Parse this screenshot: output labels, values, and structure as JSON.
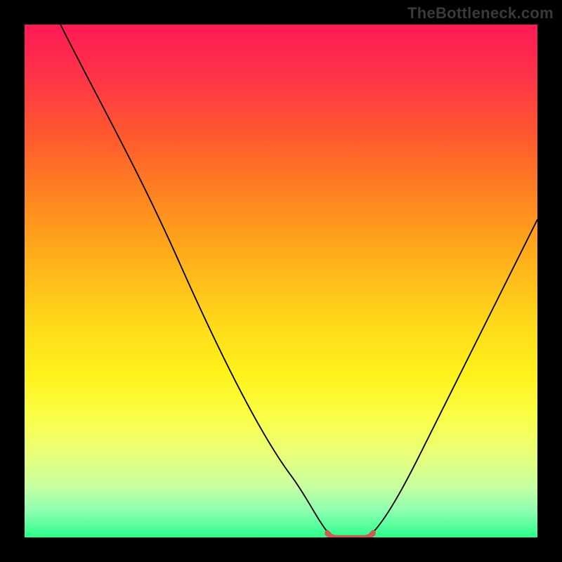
{
  "watermark": "TheBottleneck.com",
  "chart_data": {
    "type": "line",
    "title": "",
    "xlabel": "",
    "ylabel": "",
    "xlim": [
      0,
      100
    ],
    "ylim": [
      0,
      100
    ],
    "grid": false,
    "background_gradient": {
      "top": "#ff1a55",
      "mid": "#ffe81a",
      "bottom": "#2aff8a"
    },
    "series": [
      {
        "name": "curve-left",
        "color": "#000000",
        "x": [
          7,
          12,
          18,
          24,
          30,
          36,
          42,
          48,
          52,
          55,
          57.5,
          59.5
        ],
        "y": [
          100,
          90,
          78,
          66,
          54,
          42,
          31,
          20,
          12,
          6,
          2.5,
          0.5
        ]
      },
      {
        "name": "curve-right",
        "color": "#000000",
        "x": [
          67.5,
          70,
          73,
          77,
          82,
          88,
          94,
          100
        ],
        "y": [
          0.5,
          3,
          8,
          16,
          26,
          38,
          50,
          62
        ]
      },
      {
        "name": "trough-marker",
        "color": "#cc5a55",
        "x": [
          59.5,
          61,
          63,
          65,
          66.5,
          67.5
        ],
        "y": [
          0.5,
          0,
          0,
          0,
          0,
          0.5
        ]
      }
    ],
    "annotations": []
  }
}
